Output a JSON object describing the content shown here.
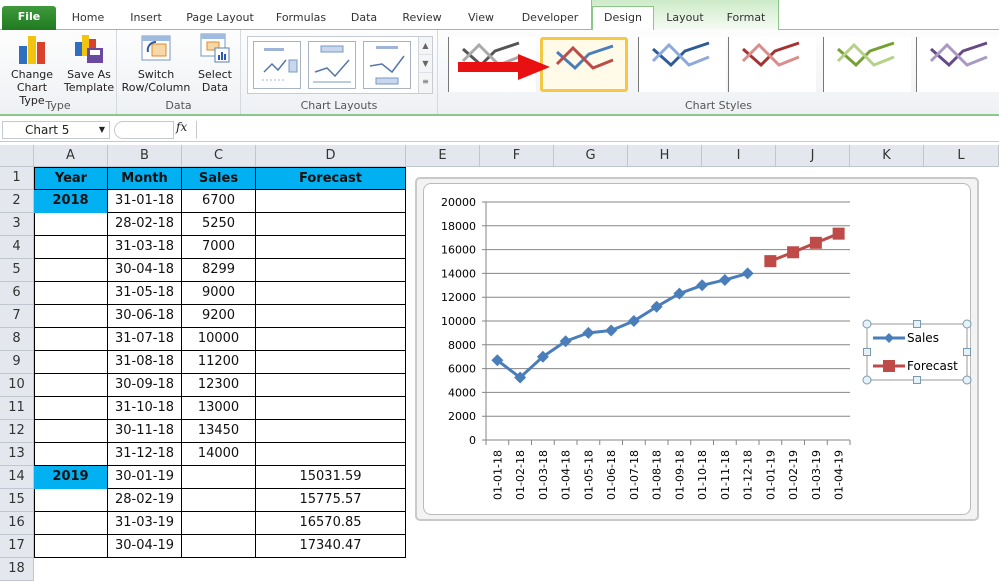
{
  "ribbon_tabs": {
    "file": "File",
    "home": "Home",
    "insert": "Insert",
    "page_layout": "Page Layout",
    "formulas": "Formulas",
    "data": "Data",
    "review": "Review",
    "view": "View",
    "developer": "Developer",
    "design": "Design",
    "layout": "Layout",
    "format": "Format"
  },
  "ribbon": {
    "type_group": {
      "label": "Type",
      "change_chart_type": [
        "Change",
        "Chart Type"
      ],
      "save_as_template": [
        "Save As",
        "Template"
      ]
    },
    "data_group": {
      "label": "Data",
      "switch_row_column": [
        "Switch",
        "Row/Column"
      ],
      "select_data": [
        "Select",
        "Data"
      ]
    },
    "chart_layouts": {
      "label": "Chart Layouts"
    },
    "chart_styles": {
      "label": "Chart Styles",
      "selected_index": 1,
      "styles": [
        {
          "name": "style-gray",
          "c1": "#555555",
          "c2": "#aaaaaa"
        },
        {
          "name": "style-multicolor",
          "c1": "#4a7ebb",
          "c2": "#be4b48"
        },
        {
          "name": "style-blue",
          "c1": "#2e5c99",
          "c2": "#8eaadb"
        },
        {
          "name": "style-red",
          "c1": "#a33331",
          "c2": "#db8d8b"
        },
        {
          "name": "style-green",
          "c1": "#77a033",
          "c2": "#b5d18a"
        },
        {
          "name": "style-purple",
          "c1": "#654a86",
          "c2": "#a99ac3"
        }
      ]
    }
  },
  "formula_bar": {
    "name_box": "Chart 5",
    "fx": "fx",
    "formula": ""
  },
  "columns": [
    "A",
    "B",
    "C",
    "D",
    "E",
    "F",
    "G",
    "H",
    "I",
    "J",
    "K",
    "L"
  ],
  "rows": [
    "1",
    "2",
    "3",
    "4",
    "5",
    "6",
    "7",
    "8",
    "9",
    "10",
    "11",
    "12",
    "13",
    "14",
    "15",
    "16",
    "17",
    "18"
  ],
  "table": {
    "headers": [
      "Year",
      "Month",
      "Sales",
      "Forecast"
    ],
    "rows": [
      [
        "2018",
        "31-01-18",
        "6700",
        ""
      ],
      [
        "",
        "28-02-18",
        "5250",
        ""
      ],
      [
        "",
        "31-03-18",
        "7000",
        ""
      ],
      [
        "",
        "30-04-18",
        "8299",
        ""
      ],
      [
        "",
        "31-05-18",
        "9000",
        ""
      ],
      [
        "",
        "30-06-18",
        "9200",
        ""
      ],
      [
        "",
        "31-07-18",
        "10000",
        ""
      ],
      [
        "",
        "31-08-18",
        "11200",
        ""
      ],
      [
        "",
        "30-09-18",
        "12300",
        ""
      ],
      [
        "",
        "31-10-18",
        "13000",
        ""
      ],
      [
        "",
        "30-11-18",
        "13450",
        ""
      ],
      [
        "",
        "31-12-18",
        "14000",
        ""
      ],
      [
        "2019",
        "30-01-19",
        "",
        "15031.59"
      ],
      [
        "",
        "28-02-19",
        "",
        "15775.57"
      ],
      [
        "",
        "31-03-19",
        "",
        "16570.85"
      ],
      [
        "",
        "30-04-19",
        "",
        "17340.47"
      ]
    ]
  },
  "chart_data": {
    "type": "line",
    "title": "",
    "xlabel": "",
    "ylabel": "",
    "categories": [
      "01-01-18",
      "01-02-18",
      "01-03-18",
      "01-04-18",
      "01-05-18",
      "01-06-18",
      "01-07-18",
      "01-08-18",
      "01-09-18",
      "01-10-18",
      "01-11-18",
      "01-12-18",
      "01-01-19",
      "01-02-19",
      "01-03-19",
      "01-04-19"
    ],
    "series": [
      {
        "name": "Sales",
        "color": "#4a7ebb",
        "marker": "diamond",
        "values": [
          6700,
          5250,
          7000,
          8299,
          9000,
          9200,
          10000,
          11200,
          12300,
          13000,
          13450,
          14000,
          null,
          null,
          null,
          null
        ]
      },
      {
        "name": "Forecast",
        "color": "#be4b48",
        "marker": "square",
        "values": [
          null,
          null,
          null,
          null,
          null,
          null,
          null,
          null,
          null,
          null,
          null,
          null,
          15031.59,
          15775.57,
          16570.85,
          17340.47
        ]
      }
    ],
    "ylim": [
      0,
      20000
    ],
    "yticks": [
      "0",
      "2000",
      "4000",
      "6000",
      "8000",
      "10000",
      "12000",
      "14000",
      "16000",
      "18000",
      "20000"
    ],
    "grid": true,
    "legend": "right"
  },
  "colors": {
    "header_fill": "#00b0f0",
    "accent_green": "#1f7a21",
    "arrow_red": "#e81010"
  }
}
